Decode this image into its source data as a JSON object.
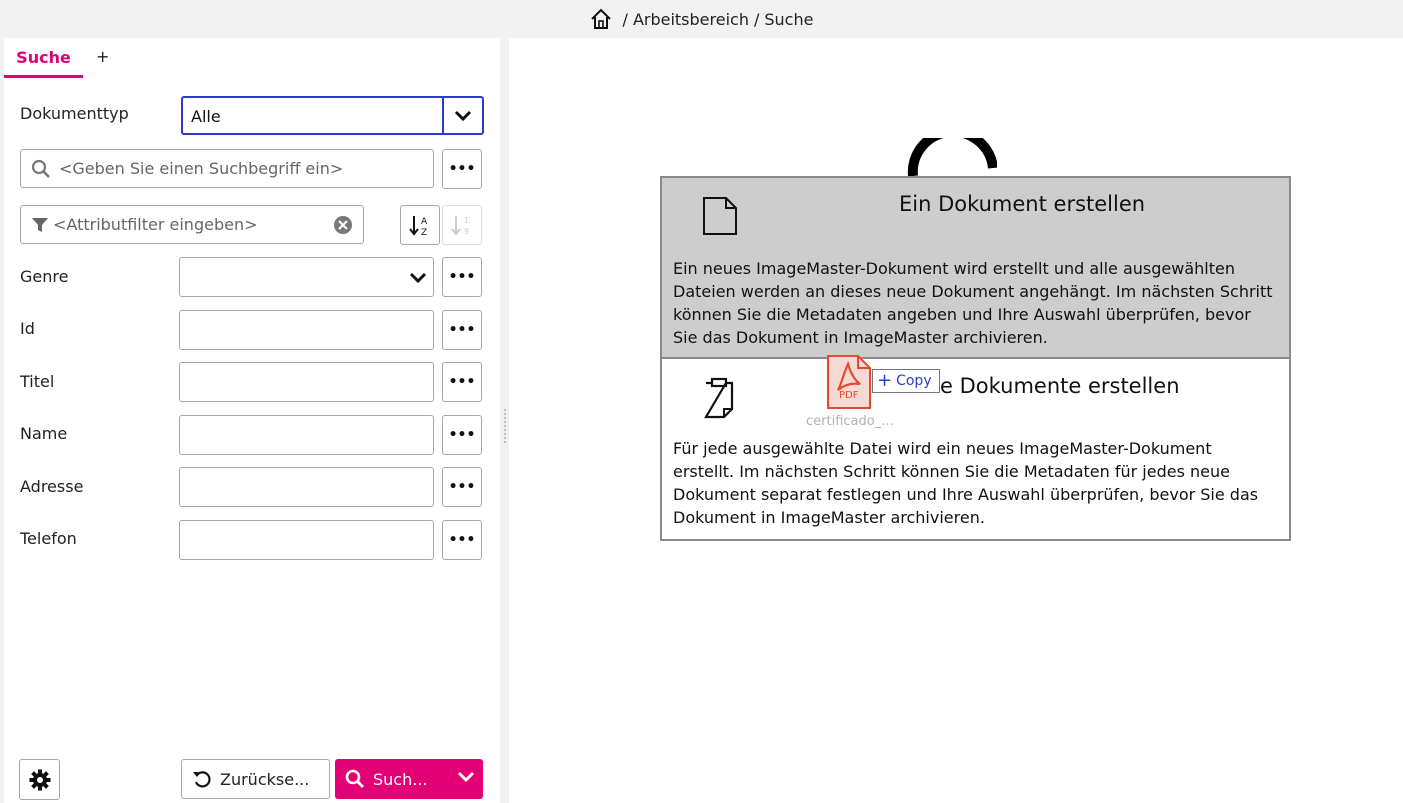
{
  "breadcrumb": {
    "separator": "/",
    "items": [
      "Arbeitsbereich",
      "Suche"
    ]
  },
  "tabs": {
    "active": "Suche",
    "add": "+"
  },
  "doctype": {
    "label": "Dokumenttyp",
    "value": "Alle"
  },
  "search": {
    "placeholder": "<Geben Sie einen Suchbegriff ein>"
  },
  "filter": {
    "placeholder": "<Attributfilter eingeben>"
  },
  "fields": [
    {
      "label": "Genre",
      "value": ""
    },
    {
      "label": "Id",
      "value": ""
    },
    {
      "label": "Titel",
      "value": ""
    },
    {
      "label": "Name",
      "value": ""
    },
    {
      "label": "Adresse",
      "value": ""
    },
    {
      "label": "Telefon",
      "value": ""
    }
  ],
  "buttons": {
    "reset": "Zurückse...",
    "search": "Such..."
  },
  "dialog": {
    "option1": {
      "title": "Ein Dokument erstellen",
      "description": "Ein neues ImageMaster-Dokument wird erstellt und alle ausgewählten Dateien werden an dieses neue Dokument angehängt. Im nächsten Schritt können Sie die Metadaten angeben und Ihre Auswahl überprüfen, bevor Sie das Dokument in ImageMaster archivieren."
    },
    "option2": {
      "title": "e Dokumente erstellen",
      "description": "Für jede ausgewählte Datei wird ein neues ImageMaster-Dokument erstellt. Im nächsten Schritt können Sie die Metadaten für jedes neue Dokument separat festlegen und Ihre Auswahl überprüfen, bevor Sie das Dokument in ImageMaster archivieren."
    }
  },
  "drag": {
    "file_label": "PDF",
    "file_name": "certificado_...",
    "copy_label": "Copy"
  },
  "colors": {
    "accent": "#e20074",
    "focus": "#2a3cc6"
  }
}
